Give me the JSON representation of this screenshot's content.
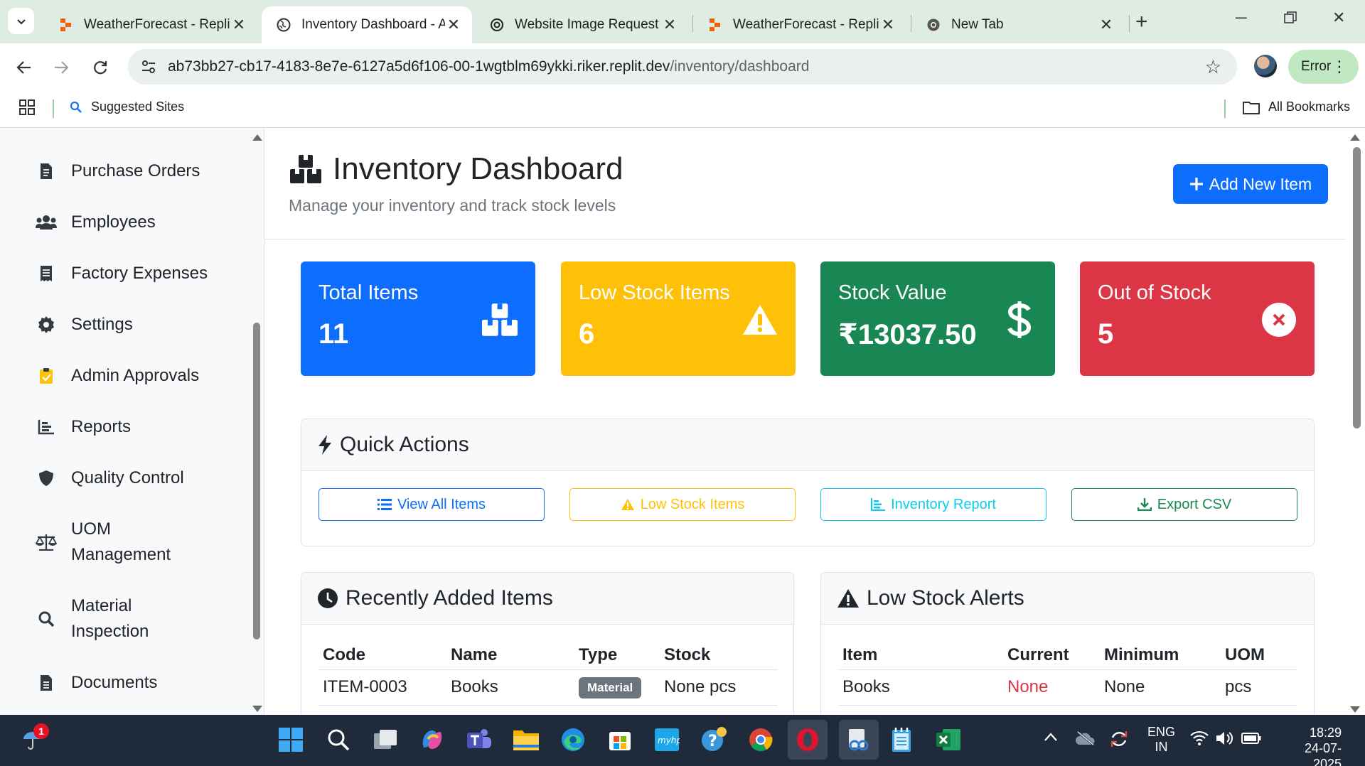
{
  "browser": {
    "tabs": [
      {
        "title": "WeatherForecast - Replit",
        "favicon": "replit-icon"
      },
      {
        "title": "Inventory Dashboard - AI",
        "favicon": "globe-icon",
        "active": true
      },
      {
        "title": "Website Image Request",
        "favicon": "chatgpt-icon"
      },
      {
        "title": "WeatherForecast - Replit",
        "favicon": "replit-icon"
      },
      {
        "title": "New Tab",
        "favicon": "chrome-icon"
      }
    ],
    "url_host": "ab73bb27-cb17-4183-8e7e-6127a5d6f106-00-1wgtblm69ykki.riker.replit.dev",
    "url_path": "/inventory/dashboard",
    "error_label": "Error",
    "bookmarks": {
      "suggested": "Suggested Sites",
      "all": "All Bookmarks"
    }
  },
  "sidebar": {
    "items": [
      {
        "label": "Purchase Orders",
        "icon": "file-invoice-icon"
      },
      {
        "label": "Employees",
        "icon": "users-icon"
      },
      {
        "label": "Factory Expenses",
        "icon": "receipt-icon"
      },
      {
        "label": "Settings",
        "icon": "gear-icon"
      },
      {
        "label": "Admin Approvals",
        "icon": "clipboard-check-icon"
      },
      {
        "label": "Reports",
        "icon": "chart-icon"
      },
      {
        "label": "Quality Control",
        "icon": "shield-icon"
      },
      {
        "label": "UOM Management",
        "icon": "balance-scale-icon"
      },
      {
        "label": "Material Inspection",
        "icon": "search-icon"
      },
      {
        "label": "Documents",
        "icon": "document-icon"
      }
    ]
  },
  "header": {
    "title": "Inventory Dashboard",
    "subtitle": "Manage your inventory and track stock levels",
    "add_button": "Add New Item"
  },
  "stats": [
    {
      "label": "Total Items",
      "value": "11",
      "color": "#0d6efd",
      "icon": "boxes-icon"
    },
    {
      "label": "Low Stock Items",
      "value": "6",
      "color": "#ffc107",
      "icon": "warning-icon"
    },
    {
      "label": "Stock Value",
      "value": "₹13037.50",
      "color": "#198754",
      "icon": "dollar-icon"
    },
    {
      "label": "Out of Stock",
      "value": "5",
      "color": "#dc3545",
      "icon": "times-circle-icon"
    }
  ],
  "quick_actions": {
    "title": "Quick Actions",
    "buttons": [
      {
        "label": "View All Items",
        "color": "#0d6efd"
      },
      {
        "label": "Low Stock Items",
        "color": "#ffc107"
      },
      {
        "label": "Inventory Report",
        "color": "#0dcaf0"
      },
      {
        "label": "Export CSV",
        "color": "#198754"
      }
    ]
  },
  "recent_items": {
    "title": "Recently Added Items",
    "columns": [
      "Code",
      "Name",
      "Type",
      "Stock"
    ],
    "rows": [
      {
        "code": "ITEM-0003",
        "name": "Books",
        "type": "Material",
        "stock": "None pcs"
      }
    ]
  },
  "low_stock": {
    "title": "Low Stock Alerts",
    "columns": [
      "Item",
      "Current",
      "Minimum",
      "UOM"
    ],
    "rows": [
      {
        "item": "Books",
        "current": "None",
        "minimum": "None",
        "uom": "pcs"
      }
    ]
  },
  "taskbar": {
    "notification_count": "1",
    "lang_top": "ENG",
    "lang_bottom": "IN",
    "time": "18:29",
    "date": "24-07-2025"
  }
}
